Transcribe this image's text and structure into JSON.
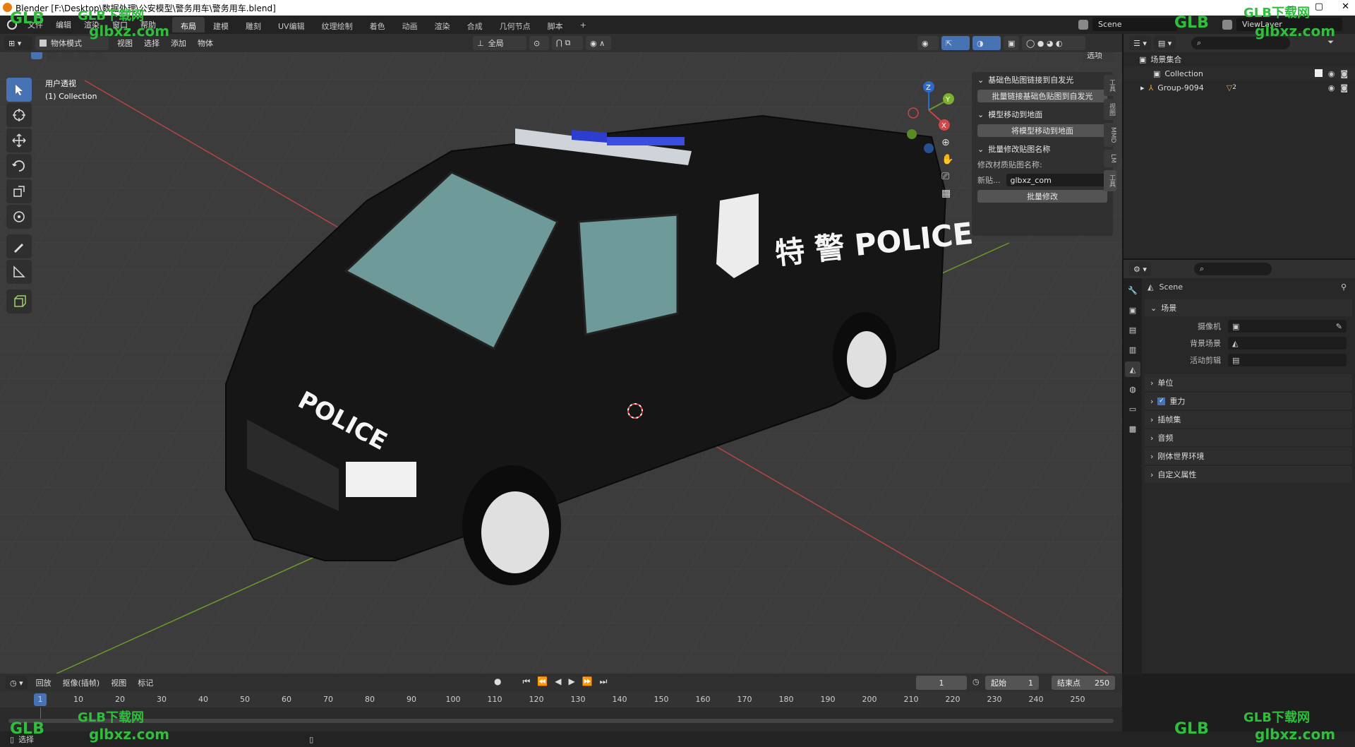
{
  "window": {
    "title": "Blender [F:\\Desktop\\数据处理\\公安模型\\警务用车\\警务用车.blend]",
    "min": "—",
    "max": "▢",
    "close": "✕"
  },
  "menu": {
    "items": [
      "文件",
      "编辑",
      "渲染",
      "窗口",
      "帮助"
    ],
    "workspaces": [
      "布局",
      "建模",
      "雕刻",
      "UV编辑",
      "纹理绘制",
      "着色",
      "动画",
      "渲染",
      "合成",
      "几何节点",
      "脚本"
    ],
    "add_workspace": "+",
    "scene": "Scene",
    "viewlayer": "ViewLayer"
  },
  "viewport_header": {
    "mode": "物体模式",
    "menus": [
      "视图",
      "选择",
      "添加",
      "物体"
    ],
    "transform": "全局",
    "options": "选项"
  },
  "viewport": {
    "view_name": "用户透视",
    "collection": "(1) Collection",
    "decals": {
      "side": "特 警 POLICE",
      "hood": "POLICE"
    },
    "gizmo": {
      "x": "X",
      "y": "Y",
      "z": "Z"
    }
  },
  "npanel": {
    "sections": [
      {
        "title": "基础色贴图链接到自发光",
        "button": "批量链接基础色贴图到自发光"
      },
      {
        "title": "模型移动到地面",
        "button": "将模型移动到地面"
      },
      {
        "title": "批量修改贴图名称",
        "label": "修改材质贴图名称:",
        "field_label": "新贴...",
        "field_value": "glbxz_com",
        "button": "批量修改"
      }
    ],
    "tabs": [
      "工具",
      "视图",
      "MMD",
      "LM",
      "工具"
    ]
  },
  "outliner": {
    "root": "场景集合",
    "rows": [
      {
        "name": "Collection"
      },
      {
        "name": "Group-9094",
        "badge": "2"
      }
    ]
  },
  "properties": {
    "scene_name": "Scene",
    "scene_section": "场景",
    "fields": [
      {
        "label": "摄像机",
        "value": ""
      },
      {
        "label": "背景场景",
        "value": ""
      },
      {
        "label": "活动剪辑",
        "value": ""
      }
    ],
    "sections": [
      "单位",
      "重力",
      "插帧集",
      "音频",
      "刚体世界环境",
      "自定义属性"
    ],
    "gravity_checked": true
  },
  "timeline": {
    "menus": [
      "回放",
      "抠像(插帧)",
      "视图",
      "标记"
    ],
    "current_frame": "1",
    "start_label": "起始",
    "start": "1",
    "end_label": "结束点",
    "end": "250",
    "ticks": [
      "1",
      "10",
      "20",
      "30",
      "40",
      "50",
      "60",
      "70",
      "80",
      "90",
      "100",
      "110",
      "120",
      "130",
      "140",
      "150",
      "160",
      "170",
      "180",
      "190",
      "200",
      "210",
      "220",
      "230",
      "240",
      "250"
    ]
  },
  "statusbar": {
    "left": "选择"
  },
  "watermarks": {
    "brand": "GLB下载网",
    "url": "glbxz.com",
    "logo": "GLB"
  },
  "colors": {
    "accent": "#4772b3",
    "header": "#303030",
    "viewport": "#3c3c3c",
    "axis_x": "#c84646",
    "axis_y": "#6a9a2a"
  }
}
